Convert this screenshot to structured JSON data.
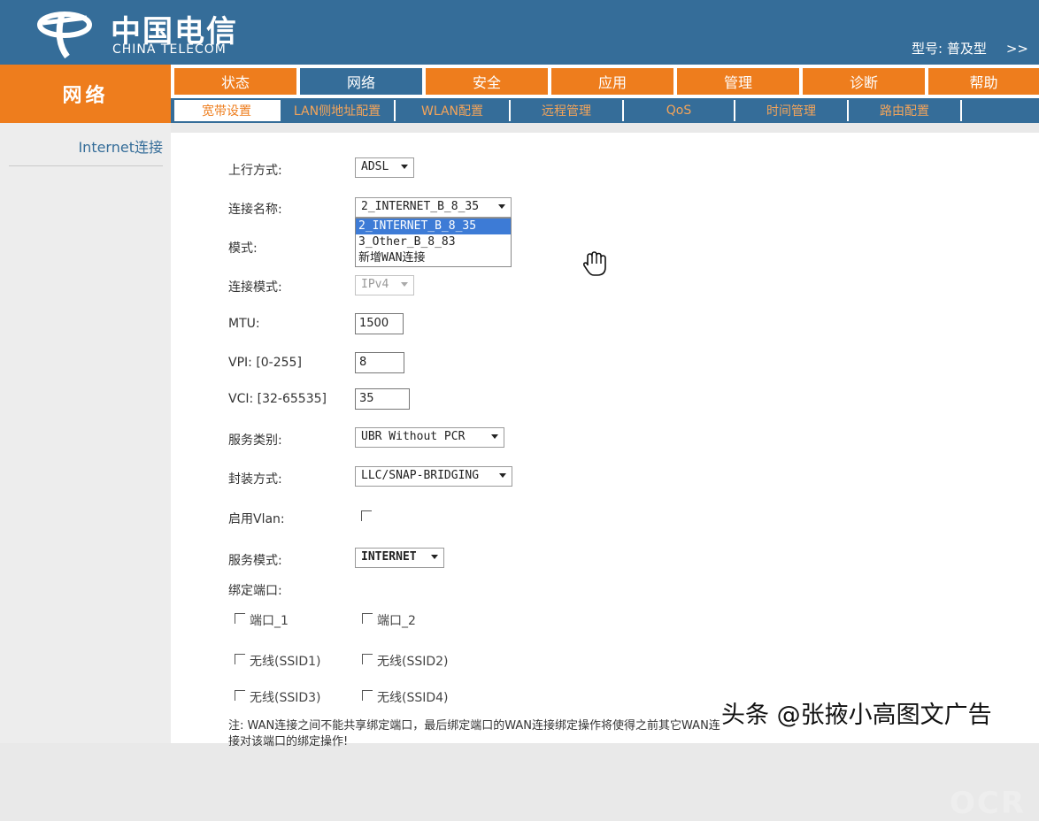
{
  "header": {
    "brand_cn": "中国电信",
    "brand_en": "CHINA TELECOM",
    "model_label": "型号: 普及型",
    "collapse_glyph": ">>"
  },
  "section_title": "网络",
  "top_tabs": [
    {
      "label": "状态"
    },
    {
      "label": "网络"
    },
    {
      "label": "安全"
    },
    {
      "label": "应用"
    },
    {
      "label": "管理"
    },
    {
      "label": "诊断"
    },
    {
      "label": "帮助"
    }
  ],
  "sub_tabs": [
    {
      "label": "宽带设置"
    },
    {
      "label": "LAN侧地址配置"
    },
    {
      "label": "WLAN配置"
    },
    {
      "label": "远程管理"
    },
    {
      "label": "QoS"
    },
    {
      "label": "时间管理"
    },
    {
      "label": "路由配置"
    }
  ],
  "left_nav": {
    "item": "Internet连接"
  },
  "form": {
    "uplink_label": "上行方式:",
    "uplink_value": "ADSL",
    "conn_name_label": "连接名称:",
    "conn_name_value": "2_INTERNET_B_8_35",
    "conn_name_options": [
      "2_INTERNET_B_8_35",
      "3_Other_B_8_83",
      "新增WAN连接"
    ],
    "mode_label": "模式:",
    "conn_mode_label": "连接模式:",
    "conn_mode_value": "IPv4",
    "mtu_label": "MTU:",
    "mtu_value": "1500",
    "vpi_label": "VPI: [0-255]",
    "vpi_value": "8",
    "vci_label": "VCI: [32-65535]",
    "vci_value": "35",
    "service_class_label": "服务类别:",
    "service_class_value": "UBR Without PCR",
    "encap_label": "封装方式:",
    "encap_value": "LLC/SNAP-BRIDGING",
    "vlan_label": "启用Vlan:",
    "service_mode_label": "服务模式:",
    "service_mode_value": "INTERNET",
    "bind_label": "绑定端口:",
    "ports": [
      "端口_1",
      "端口_2",
      "无线(SSID1)",
      "无线(SSID2)",
      "无线(SSID3)",
      "无线(SSID4)"
    ],
    "note": "注: WAN连接之间不能共享绑定端口，最后绑定端口的WAN连接绑定操作将使得之前其它WAN连接对该端口的绑定操作!"
  },
  "watermark": "头条 @张掖小高图文广告",
  "watermark_small": "OCR"
}
